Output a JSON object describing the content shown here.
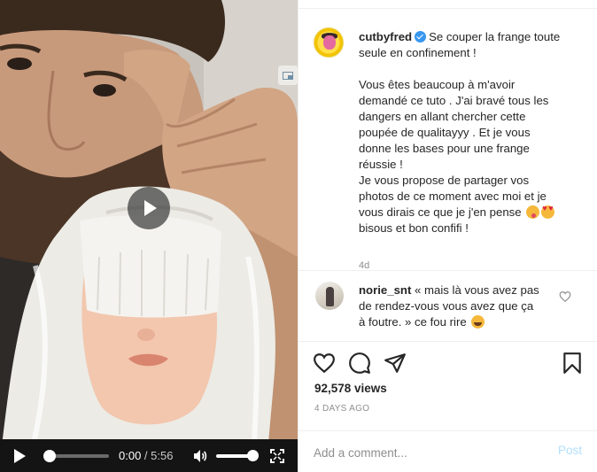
{
  "video": {
    "current_time": "0:00",
    "separator": " / ",
    "duration": "5:56",
    "progress": 0,
    "volume": 1
  },
  "post": {
    "username": "cutbyfred",
    "verified": true,
    "caption_lines": [
      "Se couper la frange toute",
      "seule en confinement !",
      "",
      "Vous êtes beaucoup à m'avoir",
      "demandé ce tuto . J'ai bravé tous les",
      "dangers en allant chercher cette",
      "poupée de qualitayyy . Et je vous",
      "donne les bases pour une frange",
      "réussie !",
      "Je vous propose de partager vos",
      "photos de ce moment avec moi et je",
      "vous dirais ce que je j'en pense",
      "bisous et bon confifi !"
    ],
    "caption_emojis": [
      "face-savoring-food-emoji",
      "heart-eyes-emoji"
    ],
    "age": "4d"
  },
  "comment": {
    "username": "norie_snt",
    "lines": [
      "« mais là vous avez pas",
      "de rendez-vous vous avez que ça",
      "à foutre. » ce fou rire"
    ],
    "emoji": "tears-of-joy-emoji"
  },
  "stats": {
    "views": "92,578 views",
    "posted": "4 DAYS AGO"
  },
  "add_comment": {
    "placeholder": "Add a comment...",
    "post_label": "Post"
  },
  "colors": {
    "accent": "#3897f0",
    "post_disabled": "#b2dffc",
    "muted": "#8e8e8e",
    "text": "#262626",
    "controls_bg": "#141414"
  }
}
